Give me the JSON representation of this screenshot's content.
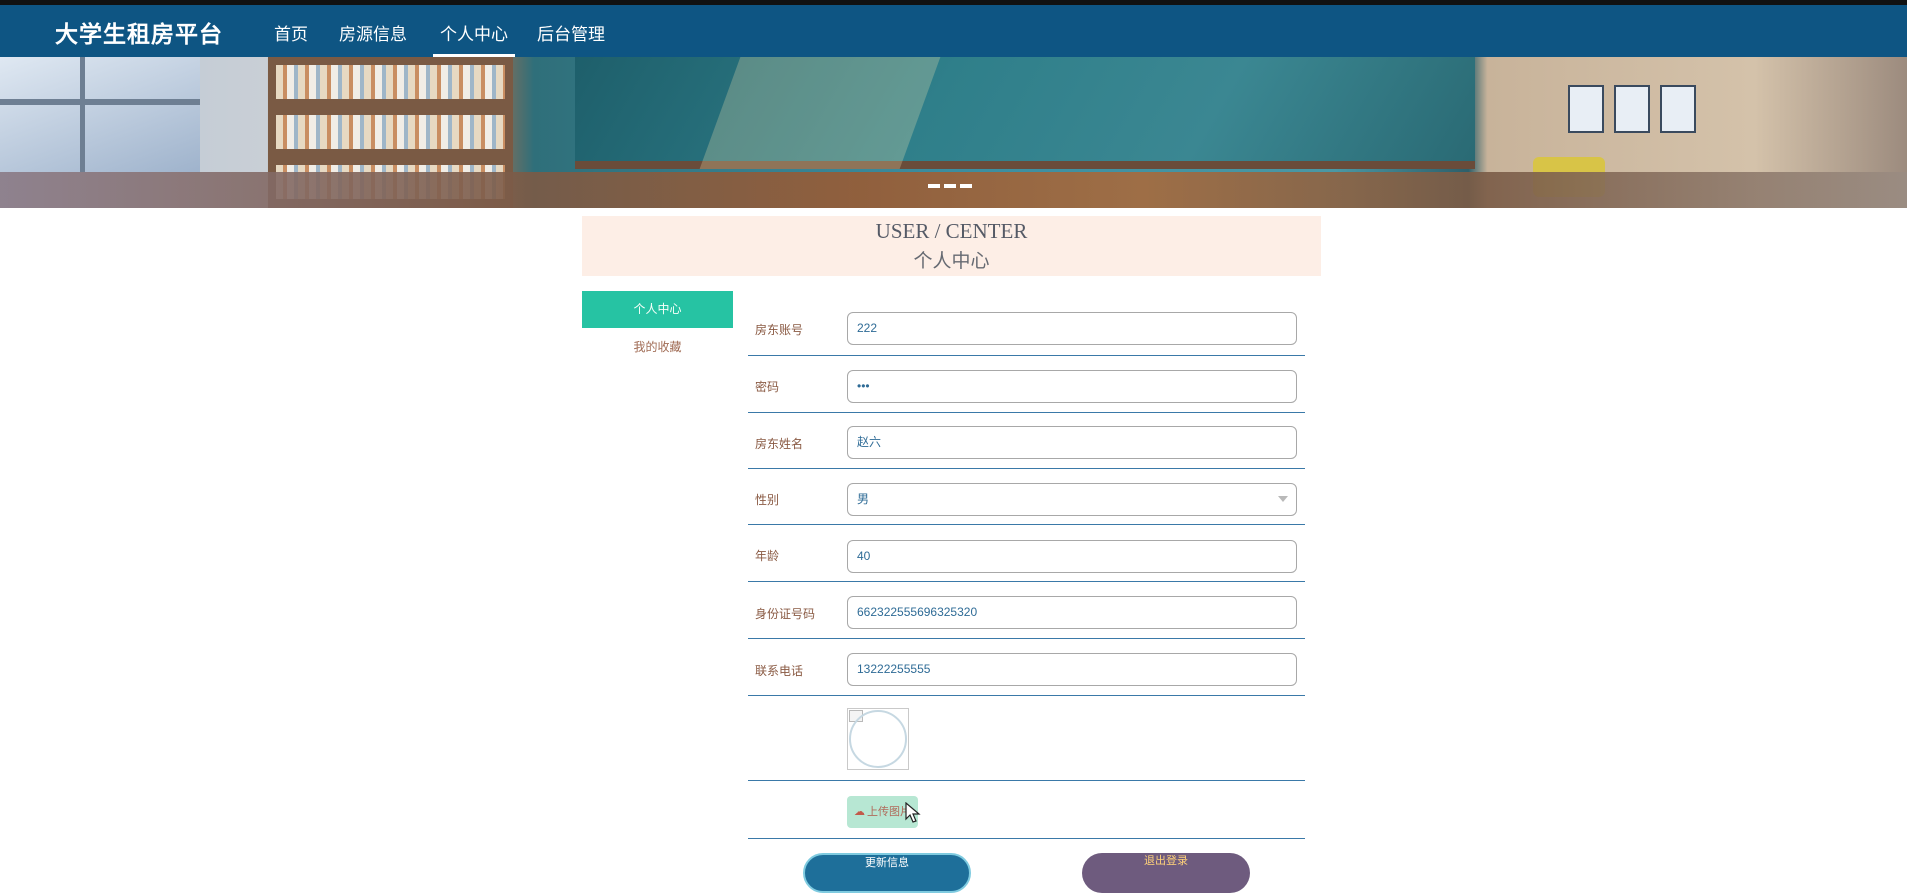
{
  "colors": {
    "navbar": "#0e5583",
    "accent_green": "#26c3a3",
    "header_box": "#fdeee6",
    "row_line": "#3a79a8",
    "input_text": "#2e6b96",
    "label_text": "#8a5a43",
    "update_button": "#1e6f9a",
    "logout_button": "#6e5b7e"
  },
  "navbar": {
    "brand": "大学生租房平台",
    "items": [
      {
        "label": "首页"
      },
      {
        "label": "房源信息"
      },
      {
        "label": "个人中心",
        "active": true
      },
      {
        "label": "后台管理"
      }
    ]
  },
  "banner": {
    "carousel_indicators": 3
  },
  "header": {
    "title_en": "USER / CENTER",
    "title_cn": "个人中心"
  },
  "sidebar": {
    "items": [
      {
        "label": "个人中心",
        "active": true
      },
      {
        "label": "我的收藏"
      }
    ]
  },
  "form": {
    "fields": [
      {
        "label": "房东账号",
        "value": "222"
      },
      {
        "label": "密码",
        "value": "•••"
      },
      {
        "label": "房东姓名",
        "value": "赵六"
      },
      {
        "label": "性别",
        "value": "男"
      },
      {
        "label": "年龄",
        "value": "40"
      },
      {
        "label": "身份证号码",
        "value": "662322555696325320"
      },
      {
        "label": "联系电话",
        "value": "13222255555"
      }
    ],
    "upload_label": "上传图片",
    "upload_icon": "cloud-upload-icon"
  },
  "buttons": {
    "update": "更新信息",
    "logout": "退出登录"
  }
}
